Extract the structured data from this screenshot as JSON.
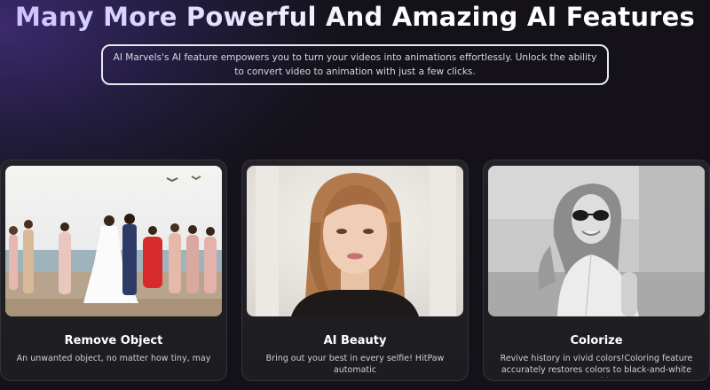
{
  "header": {
    "headline": "Many More Powerful And Amazing AI Features",
    "subtitle": "AI Marvels's AI feature empowers you to turn your videos into animations effortlessly. Unlock the ability to convert video to animation with just a few clicks."
  },
  "cards": [
    {
      "title": "Remove Object",
      "description": "An unwanted object, no matter how tiny, may",
      "image": "beach-wedding-photo"
    },
    {
      "title": "AI Beauty",
      "description": "Bring out your best in every selfie! HitPaw automatic",
      "image": "woman-portrait-photo"
    },
    {
      "title": "Colorize",
      "description": "Revive history in vivid colors!Coloring feature accurately restores colors to black-and-white or old",
      "image": "black-and-white-woman-photo"
    }
  ],
  "colors": {
    "background": "#141218",
    "accent_purple": "#3b2a6e",
    "card_bg": "#232228"
  }
}
